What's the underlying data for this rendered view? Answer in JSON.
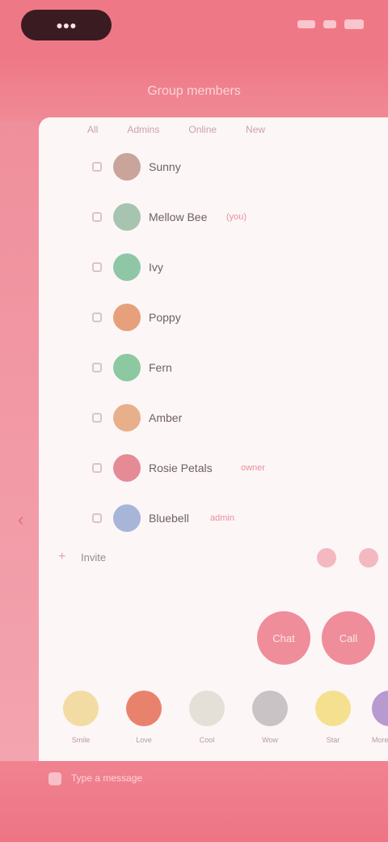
{
  "status": {
    "pill_text": "●●●",
    "time": ""
  },
  "header": {
    "title": "Group members"
  },
  "tabs": [
    {
      "label": "All"
    },
    {
      "label": "Admins"
    },
    {
      "label": "Online"
    },
    {
      "label": "New"
    }
  ],
  "members": [
    {
      "name": "Sunny",
      "tag": "",
      "avatar_color": "#c9a49a"
    },
    {
      "name": "Mellow Bee",
      "tag": "(you)",
      "avatar_color": "#a7c4b0"
    },
    {
      "name": "Ivy",
      "tag": "",
      "avatar_color": "#8fc7a6"
    },
    {
      "name": "Poppy",
      "tag": "",
      "avatar_color": "#e7a07c"
    },
    {
      "name": "Fern",
      "tag": "",
      "avatar_color": "#8cc9a0"
    },
    {
      "name": "Amber",
      "tag": "",
      "avatar_color": "#e8b08a"
    },
    {
      "name": "Rosie Petals",
      "tag": "owner",
      "avatar_color": "#e48b96"
    },
    {
      "name": "Bluebell",
      "tag": "admin",
      "avatar_color": "#a7b5d8"
    }
  ],
  "compose": {
    "plus": "+",
    "label": "Invite"
  },
  "actions": [
    {
      "label": "Chat"
    },
    {
      "label": "Call"
    }
  ],
  "categories": [
    {
      "label": "Smile",
      "color": "#f3dba4"
    },
    {
      "label": "Love",
      "color": "#e9826c"
    },
    {
      "label": "Cool",
      "color": "#e4e0d8"
    },
    {
      "label": "Wow",
      "color": "#c9c3c6"
    },
    {
      "label": "Star",
      "color": "#f4e08f"
    },
    {
      "label": "More",
      "color": "#b79ad0"
    }
  ],
  "bottom": {
    "text": "Type a message"
  }
}
